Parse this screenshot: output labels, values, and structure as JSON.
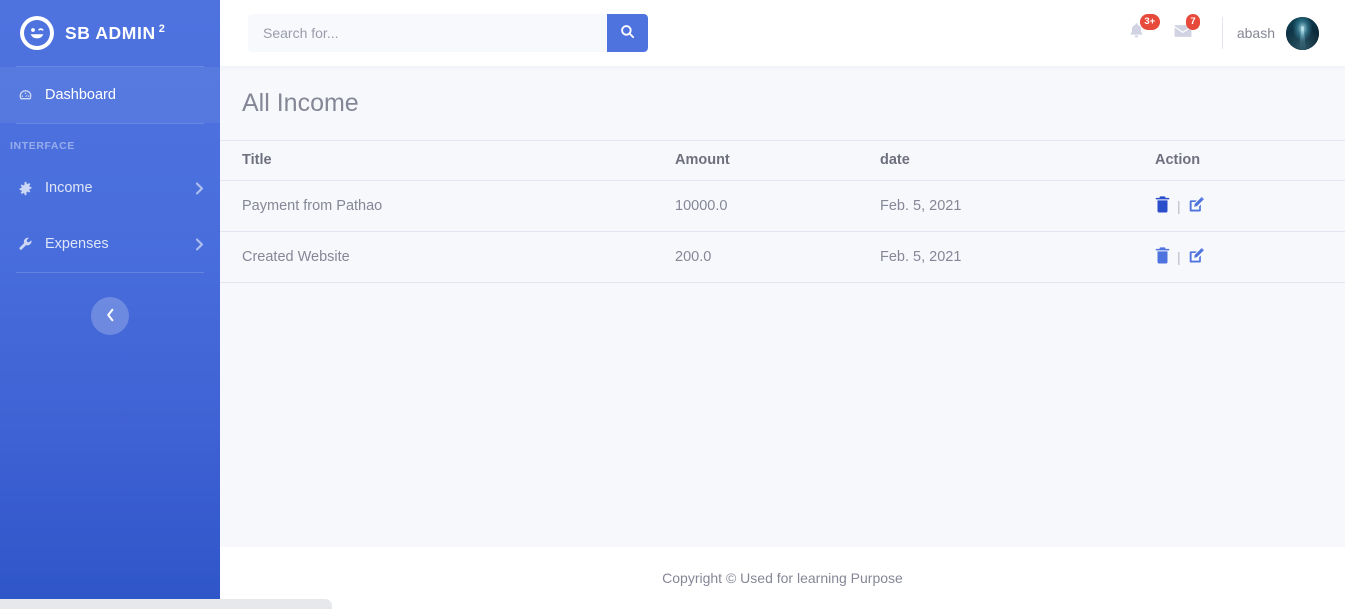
{
  "sidebar": {
    "brand": {
      "name": "SB ADMIN",
      "sup": "2",
      "logo_icon": "smiley-wink-icon"
    },
    "dashboard": {
      "label": "Dashboard",
      "icon": "tachometer-icon"
    },
    "heading": "INTERFACE",
    "items": [
      {
        "label": "Income",
        "icon": "cog-icon",
        "chevron": "chevron-right-icon"
      },
      {
        "label": "Expenses",
        "icon": "wrench-icon",
        "chevron": "chevron-right-icon"
      }
    ],
    "toggle": {
      "icon": "chevron-left-icon"
    }
  },
  "topbar": {
    "search": {
      "placeholder": "Search for...",
      "value": "",
      "button_icon": "search-icon"
    },
    "alerts": {
      "icon": "bell-icon",
      "badge": "3+"
    },
    "messages": {
      "icon": "envelope-icon",
      "badge": "7"
    },
    "user": {
      "name": "abash",
      "avatar_icon": "user-avatar"
    }
  },
  "main": {
    "page_title": "All Income",
    "table": {
      "columns": [
        "Title",
        "Amount",
        "date",
        "Action"
      ],
      "rows": [
        {
          "title": "Payment from Pathao",
          "amount": "10000.0",
          "date": "Feb. 5, 2021",
          "actions": {
            "delete_icon": "trash-icon",
            "separator": "|",
            "edit_icon": "pen-to-square-icon"
          }
        },
        {
          "title": "Created Website",
          "amount": "200.0",
          "date": "Feb. 5, 2021",
          "actions": {
            "delete_icon": "trash-icon",
            "separator": "|",
            "edit_icon": "pen-to-square-icon"
          }
        }
      ]
    }
  },
  "footer": {
    "text": "Copyright © Used for learning Purpose"
  },
  "statusbar": {
    "text": ""
  },
  "colors": {
    "brand_blue": "#4e73df",
    "sidebar_gradient_start": "#4e73df",
    "sidebar_gradient_end": "#2e55c8",
    "badge_red": "#e74a3b",
    "content_bg": "#f7f8fc",
    "text_muted": "#858796",
    "border": "#e3e6f0",
    "action_delete": "#2b4ecb",
    "action_edit": "#4e73df"
  }
}
